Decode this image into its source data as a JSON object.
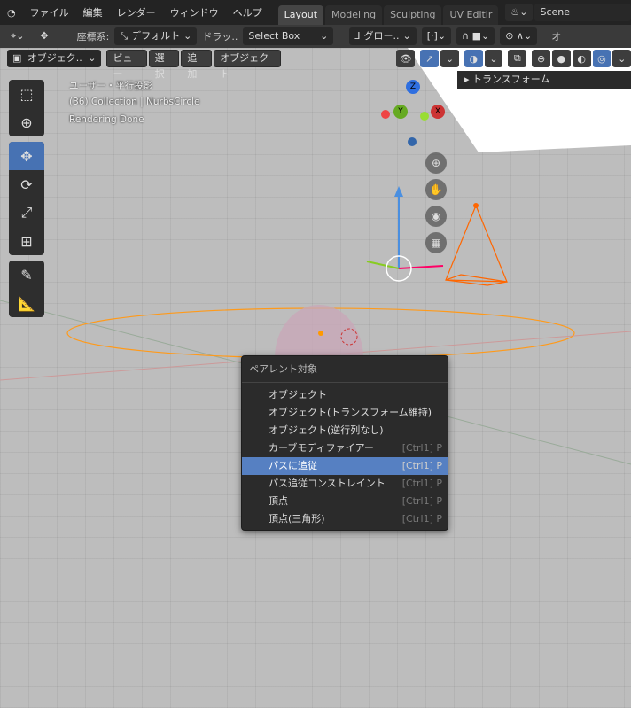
{
  "topbar": {
    "menus": [
      "ファイル",
      "編集",
      "レンダー",
      "ウィンドウ",
      "ヘルプ"
    ],
    "tabs": [
      "Layout",
      "Modeling",
      "Sculpting",
      "UV Editir"
    ],
    "active_tab": "Layout",
    "scene": "Scene"
  },
  "toolbar": {
    "coord_label": "座標系:",
    "orientation": "デフォルト",
    "drag_label": "ドラッ..",
    "select_mode": "Select Box",
    "transform_orientation": "グロー..",
    "right_label": "オ"
  },
  "header": {
    "mode": "オブジェク..",
    "menus": [
      "ビュー",
      "選択",
      "追加",
      "オブジェクト"
    ]
  },
  "overlay": {
    "view": "ユーザー・平行投影",
    "collection": "(36) Collection | NurbsCircle",
    "status": "Rendering Done"
  },
  "npanel": {
    "title": "トランスフォーム"
  },
  "gizmo": {
    "z": "Z",
    "y": "Y",
    "x": "X"
  },
  "context_menu": {
    "title": "ペアレント対象",
    "items": [
      {
        "label": "オブジェクト",
        "shortcut": ""
      },
      {
        "label": "オブジェクト(トランスフォーム維持)",
        "shortcut": ""
      },
      {
        "label": "オブジェクト(逆行列なし)",
        "shortcut": ""
      },
      {
        "label": "カーブモディファイアー",
        "shortcut": "[Ctrl1] P"
      },
      {
        "label": "パスに追従",
        "shortcut": "[Ctrl1] P",
        "highlighted": true
      },
      {
        "label": "パス追従コンストレイント",
        "shortcut": "[Ctrl1] P"
      },
      {
        "label": "頂点",
        "shortcut": "[Ctrl1] P"
      },
      {
        "label": "頂点(三角形)",
        "shortcut": "[Ctrl1] P"
      }
    ]
  },
  "colors": {
    "accent": "#4772b3",
    "highlight": "#5680c2",
    "curve": "#ff8c00"
  }
}
